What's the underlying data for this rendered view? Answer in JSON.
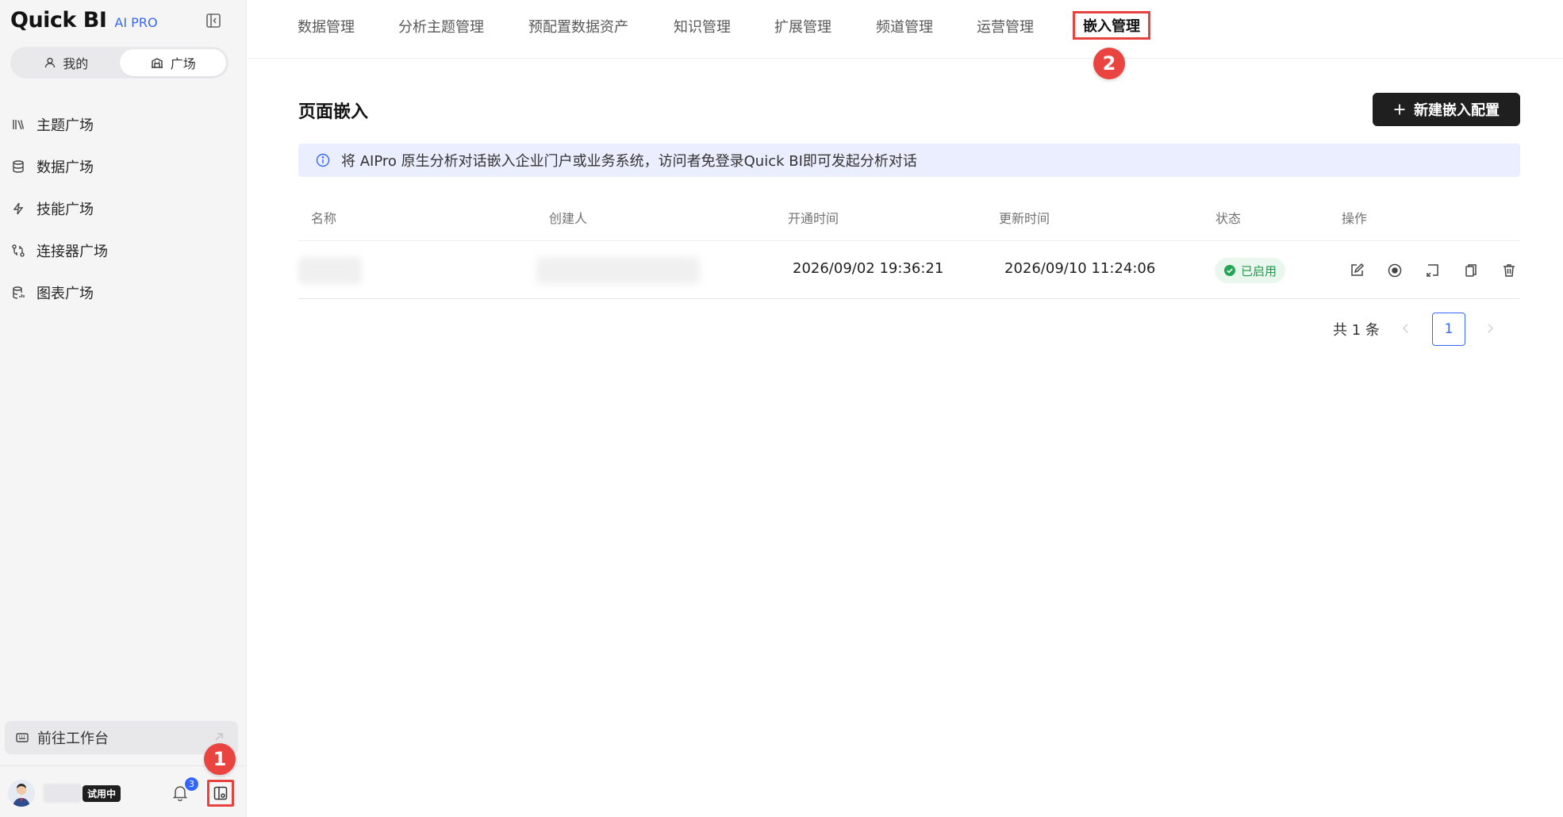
{
  "sidebar": {
    "brand": {
      "name": "Quick BI",
      "tag": "AI PRO"
    },
    "segments": [
      {
        "label": "我的",
        "active": false
      },
      {
        "label": "广场",
        "active": true
      }
    ],
    "items": [
      {
        "label": "主题广场",
        "icon": "books-icon"
      },
      {
        "label": "数据广场",
        "icon": "database-icon"
      },
      {
        "label": "技能广场",
        "icon": "lightning-icon"
      },
      {
        "label": "连接器广场",
        "icon": "connector-icon"
      },
      {
        "label": "图表广场",
        "icon": "chart-db-icon"
      }
    ],
    "workbench_label": "前往工作台",
    "user": {
      "trial_badge": "试用中"
    },
    "notification_count": "3",
    "callout_1": "1"
  },
  "tabs": [
    {
      "label": "数据管理"
    },
    {
      "label": "分析主题管理"
    },
    {
      "label": "预配置数据资产"
    },
    {
      "label": "知识管理"
    },
    {
      "label": "扩展管理"
    },
    {
      "label": "频道管理"
    },
    {
      "label": "运营管理"
    },
    {
      "label": "嵌入管理",
      "active": true
    }
  ],
  "callout_2": "2",
  "main": {
    "title": "页面嵌入",
    "new_button": "新建嵌入配置",
    "info_text": "将 AIPro 原生分析对话嵌入企业门户或业务系统，访问者免登录Quick BI即可发起分析对话",
    "table": {
      "columns": [
        "名称",
        "创建人",
        "开通时间",
        "更新时间",
        "状态",
        "操作"
      ],
      "rows": [
        {
          "opened": "2026/09/02 19:36:21",
          "updated": "2026/09/10 11:24:06",
          "status": "已启用",
          "actions": [
            "edit-icon",
            "stop-circle-icon",
            "embed-icon",
            "copy-icon",
            "delete-icon"
          ]
        }
      ]
    },
    "pagination": {
      "total": "共 1 条",
      "current": "1"
    }
  },
  "colors": {
    "accent": "#3566ff",
    "callout": "#ea4440",
    "status_ok": "#1e9a4b",
    "info_bg": "#ebeeff",
    "primary_button": "#1f1f1f"
  }
}
